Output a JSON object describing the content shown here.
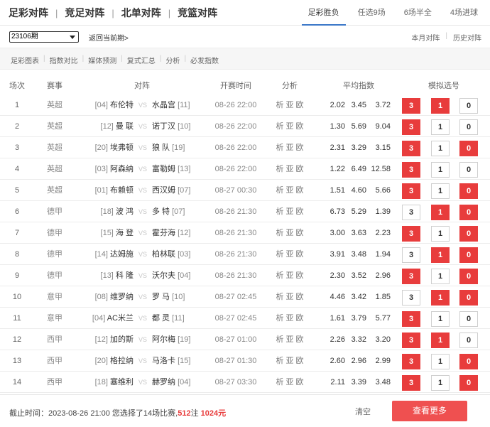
{
  "main_tabs": [
    "足彩对阵",
    "竞足对阵",
    "北单对阵",
    "竞篮对阵"
  ],
  "main_sep": "|",
  "sub_tabs": [
    "足彩胜负",
    "任选9场",
    "6场半全",
    "4场进球"
  ],
  "period": {
    "selected": "23106期",
    "return_label": "返回当前期>"
  },
  "right_links": [
    "本月对阵",
    "历史对阵"
  ],
  "right_sep": "|",
  "tools": [
    "足彩图表",
    "指数对比",
    "媒体预测",
    "复式汇总",
    "分析",
    "必发指数"
  ],
  "tool_sep": "|",
  "headers": {
    "idx": "场次",
    "league": "赛事",
    "match": "对阵",
    "time": "开赛时间",
    "analysis": "分析",
    "odds": "平均指数",
    "pick": "模拟选号"
  },
  "vs": "VS",
  "analysis_text": "析 亚 欧",
  "rows": [
    {
      "idx": "1",
      "league": "英超",
      "home_rank": "[04]",
      "home": "布伦特",
      "away": "水晶宫",
      "away_rank": "[11]",
      "time": "08-26 22:00",
      "o1": "2.02",
      "o2": "3.45",
      "o3": "3.72",
      "b3": "3",
      "b1": "1",
      "b0": "0",
      "sel": [
        true,
        true,
        false
      ]
    },
    {
      "idx": "2",
      "league": "英超",
      "home_rank": "[12]",
      "home": "曼 联",
      "away": "诺丁汉",
      "away_rank": "[10]",
      "time": "08-26 22:00",
      "o1": "1.30",
      "o2": "5.69",
      "o3": "9.04",
      "b3": "3",
      "b1": "1",
      "b0": "0",
      "sel": [
        true,
        false,
        false
      ]
    },
    {
      "idx": "3",
      "league": "英超",
      "home_rank": "[20]",
      "home": "埃弗顿",
      "away": "狼 队",
      "away_rank": "[19]",
      "time": "08-26 22:00",
      "o1": "2.31",
      "o2": "3.29",
      "o3": "3.15",
      "b3": "3",
      "b1": "1",
      "b0": "0",
      "sel": [
        true,
        false,
        true
      ]
    },
    {
      "idx": "4",
      "league": "英超",
      "home_rank": "[03]",
      "home": "阿森纳",
      "away": "富勒姆",
      "away_rank": "[13]",
      "time": "08-26 22:00",
      "o1": "1.22",
      "o2": "6.49",
      "o3": "12.58",
      "b3": "3",
      "b1": "1",
      "b0": "0",
      "sel": [
        true,
        false,
        false
      ]
    },
    {
      "idx": "5",
      "league": "英超",
      "home_rank": "[01]",
      "home": "布赖顿",
      "away": "西汉姆",
      "away_rank": "[07]",
      "time": "08-27 00:30",
      "o1": "1.51",
      "o2": "4.60",
      "o3": "5.66",
      "b3": "3",
      "b1": "1",
      "b0": "0",
      "sel": [
        true,
        false,
        true
      ]
    },
    {
      "idx": "6",
      "league": "德甲",
      "home_rank": "[18]",
      "home": "波 鸿",
      "away": "多 特",
      "away_rank": "[07]",
      "time": "08-26 21:30",
      "o1": "6.73",
      "o2": "5.29",
      "o3": "1.39",
      "b3": "3",
      "b1": "1",
      "b0": "0",
      "sel": [
        false,
        true,
        true
      ]
    },
    {
      "idx": "7",
      "league": "德甲",
      "home_rank": "[15]",
      "home": "海 登",
      "away": "霍芬海",
      "away_rank": "[12]",
      "time": "08-26 21:30",
      "o1": "3.00",
      "o2": "3.63",
      "o3": "2.23",
      "b3": "3",
      "b1": "1",
      "b0": "0",
      "sel": [
        true,
        false,
        true
      ]
    },
    {
      "idx": "8",
      "league": "德甲",
      "home_rank": "[14]",
      "home": "达姆施",
      "away": "柏林联",
      "away_rank": "[03]",
      "time": "08-26 21:30",
      "o1": "3.91",
      "o2": "3.48",
      "o3": "1.94",
      "b3": "3",
      "b1": "1",
      "b0": "0",
      "sel": [
        false,
        true,
        true
      ]
    },
    {
      "idx": "9",
      "league": "德甲",
      "home_rank": "[13]",
      "home": "科 隆",
      "away": "沃尔夫",
      "away_rank": "[04]",
      "time": "08-26 21:30",
      "o1": "2.30",
      "o2": "3.52",
      "o3": "2.96",
      "b3": "3",
      "b1": "1",
      "b0": "0",
      "sel": [
        true,
        false,
        true
      ]
    },
    {
      "idx": "10",
      "league": "意甲",
      "home_rank": "[08]",
      "home": "维罗纳",
      "away": "罗 马",
      "away_rank": "[10]",
      "time": "08-27 02:45",
      "o1": "4.46",
      "o2": "3.42",
      "o3": "1.85",
      "b3": "3",
      "b1": "1",
      "b0": "0",
      "sel": [
        false,
        true,
        true
      ]
    },
    {
      "idx": "11",
      "league": "意甲",
      "home_rank": "[04]",
      "home": "AC米兰",
      "away": "都 灵",
      "away_rank": "[11]",
      "time": "08-27 02:45",
      "o1": "1.61",
      "o2": "3.79",
      "o3": "5.77",
      "b3": "3",
      "b1": "1",
      "b0": "0",
      "sel": [
        true,
        false,
        false
      ]
    },
    {
      "idx": "12",
      "league": "西甲",
      "home_rank": "[12]",
      "home": "加的斯",
      "away": "阿尔梅",
      "away_rank": "[19]",
      "time": "08-27 01:00",
      "o1": "2.26",
      "o2": "3.32",
      "o3": "3.20",
      "b3": "3",
      "b1": "1",
      "b0": "0",
      "sel": [
        true,
        true,
        false
      ]
    },
    {
      "idx": "13",
      "league": "西甲",
      "home_rank": "[20]",
      "home": "格拉纳",
      "away": "马洛卡",
      "away_rank": "[15]",
      "time": "08-27 01:30",
      "o1": "2.60",
      "o2": "2.96",
      "o3": "2.99",
      "b3": "3",
      "b1": "1",
      "b0": "0",
      "sel": [
        true,
        false,
        true
      ]
    },
    {
      "idx": "14",
      "league": "西甲",
      "home_rank": "[18]",
      "home": "塞维利",
      "away": "赫罗纳",
      "away_rank": "[04]",
      "time": "08-27 03:30",
      "o1": "2.11",
      "o2": "3.39",
      "o3": "3.48",
      "b3": "3",
      "b1": "1",
      "b0": "0",
      "sel": [
        true,
        false,
        true
      ]
    }
  ],
  "footer": {
    "deadline_prefix": "截止时间：2023-08-26 21:00 您选择了14场比赛,",
    "bets": "512",
    "bets_unit": "注",
    "amount": "1024元",
    "clear_label": "清空",
    "more_label": "查看更多"
  },
  "colors": {
    "accent_red": "#e83c3c",
    "tab_underline": "#3c78c8"
  }
}
